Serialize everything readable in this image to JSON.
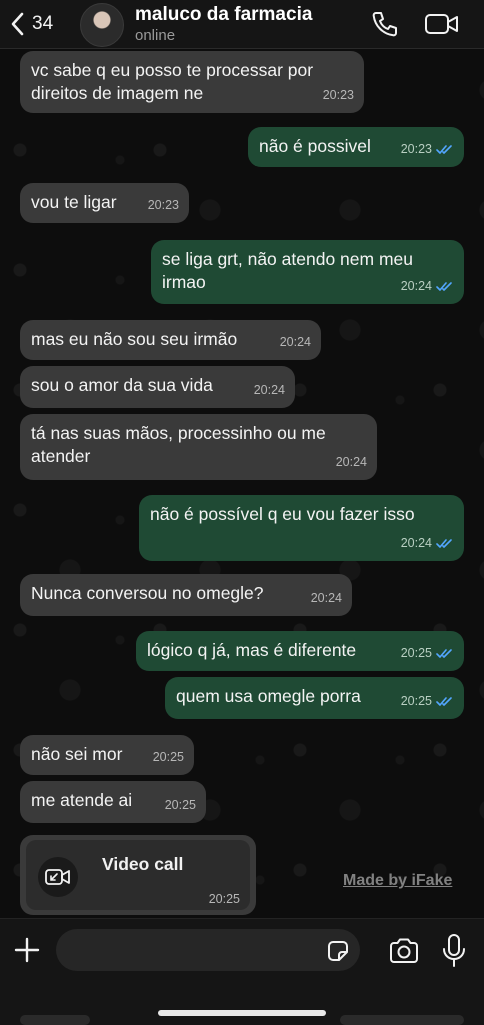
{
  "header": {
    "back_count": "34",
    "contact_name": "maluco da farmacia",
    "status": "online"
  },
  "messages": [
    {
      "direction": "in",
      "text": "vc sabe q eu posso te processar por direitos de imagem ne",
      "time": "20:23"
    },
    {
      "direction": "out",
      "text": "não é possivel",
      "time": "20:23",
      "read": true
    },
    {
      "direction": "in",
      "text": "vou te ligar",
      "time": "20:23"
    },
    {
      "direction": "out",
      "text": "se liga grt, não atendo nem meu irmao",
      "time": "20:24",
      "read": true
    },
    {
      "direction": "in",
      "text": "mas eu não sou seu irmão",
      "time": "20:24"
    },
    {
      "direction": "in",
      "text": "sou o amor da sua vida",
      "time": "20:24"
    },
    {
      "direction": "in",
      "text": "tá nas suas mãos, processinho ou me atender",
      "time": "20:24"
    },
    {
      "direction": "out",
      "text": "não é possível q eu vou fazer isso",
      "time": "20:24",
      "read": true
    },
    {
      "direction": "in",
      "text": "Nunca conversou no omegle?",
      "time": "20:24"
    },
    {
      "direction": "out",
      "text": "lógico q já, mas é diferente",
      "time": "20:25",
      "read": true
    },
    {
      "direction": "out",
      "text": "quem usa omegle porra",
      "time": "20:25",
      "read": true
    },
    {
      "direction": "in",
      "text": "não sei mor",
      "time": "20:25"
    },
    {
      "direction": "in",
      "text": "me atende ai",
      "time": "20:25"
    }
  ],
  "video_call": {
    "label": "Video call",
    "time": "20:25"
  },
  "watermark": "Made by iFake",
  "input": {
    "value": "",
    "placeholder": ""
  },
  "colors": {
    "incoming": "#3a3a3a",
    "outgoing": "#1f4a34",
    "read_ticks": "#53a6ff"
  },
  "icons": {
    "back": "chevron-left-icon",
    "call": "phone-icon",
    "video": "video-camera-icon",
    "add": "plus-icon",
    "sticker": "sticker-icon",
    "camera": "camera-icon",
    "mic": "microphone-icon",
    "ticks": "double-check-icon",
    "missed_call": "video-call-icon"
  }
}
